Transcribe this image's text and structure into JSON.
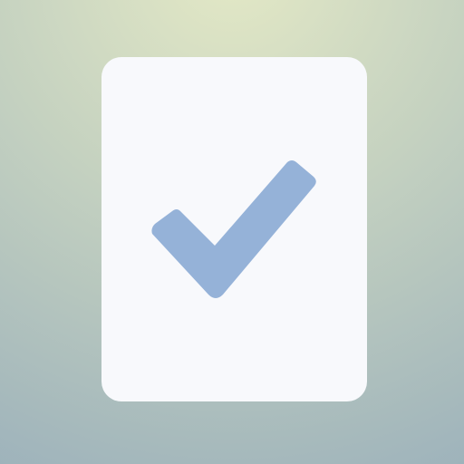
{
  "icon": {
    "name": "checklist-document-icon",
    "card_icon": "document-icon",
    "mark_icon": "checkmark-icon"
  },
  "colors": {
    "background_top": "#e4e9c6",
    "background_mid": "#c4d1c0",
    "background_bottom": "#9db2bb",
    "card": "#f8f9fc",
    "checkmark": "#95b2d8"
  }
}
